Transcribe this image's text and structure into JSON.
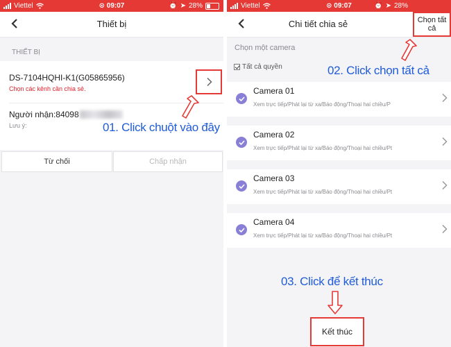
{
  "status_bar": {
    "carrier": "Viettel",
    "time": "09:07",
    "battery": "28%",
    "battery_level": 0.28
  },
  "left_screen": {
    "title": "Thiết bị",
    "section_label": "THIẾT BỊ",
    "device": {
      "name": "DS-7104HQHI-K1(G05865956)",
      "hint": "Chọn các kênh cần chia sẻ."
    },
    "receiver_label": "Người nhận:84098",
    "note_label": "Lưu ý:",
    "reject_label": "Từ chối",
    "accept_label": "Chấp nhận"
  },
  "right_screen": {
    "title": "Chi tiết chia sẻ",
    "select_all_label": "Chọn tất cả",
    "section_label": "Chọn một camera",
    "all_permissions_label": "Tất cả quyền",
    "cameras": [
      {
        "name": "Camera 01",
        "permissions": "Xem trực tiếp/Phát lại từ xa/Báo động/Thoại hai chiều/P"
      },
      {
        "name": "Camera 02",
        "permissions": "Xem trực tiếp/Phát lại từ xa/Báo động/Thoại hai chiều/Pt"
      },
      {
        "name": "Camera 03",
        "permissions": "Xem trực tiếp/Phát lại từ xa/Báo động/Thoại hai chiều/Pt"
      },
      {
        "name": "Camera 04",
        "permissions": "Xem trực tiếp/Phát lại từ xa/Báo động/Thoại hai chiều/Pt"
      }
    ],
    "finish_label": "Kết thúc"
  },
  "annotations": {
    "step1": "01. Click chuột vào đây",
    "step2": "02. Click chọn tất cả",
    "step3": "03. Click để kết thúc"
  },
  "colors": {
    "status_bar": "#e53935",
    "annotation_text": "#1f5bd8",
    "highlight_box": "#e53935",
    "camera_check": "#8a7fd6",
    "hint_text": "#e0202a"
  }
}
